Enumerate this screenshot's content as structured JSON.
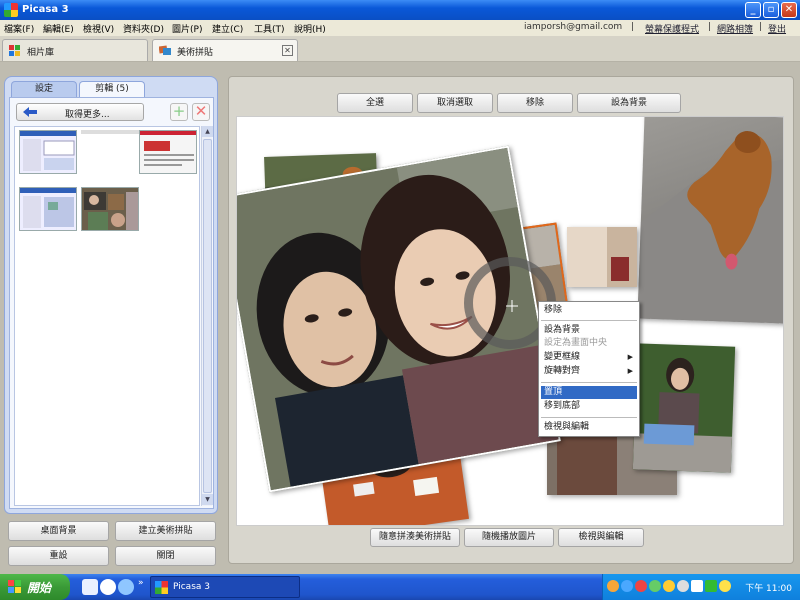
{
  "window": {
    "title": "Picasa 3"
  },
  "menu": {
    "items": [
      "檔案(F)",
      "編輯(E)",
      "檢視(V)",
      "資料夾(D)",
      "圖片(P)",
      "建立(C)",
      "工具(T)",
      "說明(H)"
    ],
    "email": "iamporsh@gmail.com",
    "screensaver": "螢幕保護程式",
    "web_albums": "網路相簿",
    "logout": "登出"
  },
  "tabs": [
    {
      "label": "相片庫"
    },
    {
      "label": "美術拼貼"
    }
  ],
  "left_panel": {
    "tabs": [
      "設定",
      "剪輯 (5)"
    ],
    "get_more": "取得更多...",
    "buttons": {
      "desktop_bg": "桌面背景",
      "create_collage": "建立美術拼貼",
      "reset": "重設",
      "close": "關閉"
    }
  },
  "top_buttons": {
    "select_all": "全選",
    "deselect": "取消選取",
    "remove": "移除",
    "set_bg": "設為背景"
  },
  "context_menu": {
    "items": [
      {
        "label": "移除",
        "state": "normal"
      },
      {
        "label": "設為背景",
        "state": "normal"
      },
      {
        "label": "設定為畫面中央",
        "state": "disabled"
      },
      {
        "label": "變更框線",
        "state": "submenu"
      },
      {
        "label": "旋轉對齊",
        "state": "submenu"
      },
      {
        "label": "置頂",
        "state": "selected"
      },
      {
        "label": "移到底部",
        "state": "normal"
      },
      {
        "label": "檢視與編輯",
        "state": "normal"
      }
    ]
  },
  "bottom_buttons": {
    "shuffle": "隨意拼湊美術拼貼",
    "random_pics": "隨機播放圖片",
    "view_edit": "檢視與編輯"
  },
  "taskbar": {
    "start": "開始",
    "task": "Picasa 3",
    "clock": "下午 11:00"
  },
  "colors": {
    "titlebar": "#0a58d8",
    "menu_selected": "#316ac5",
    "taskbar": "#245edb",
    "start_green": "#3a9a37"
  }
}
